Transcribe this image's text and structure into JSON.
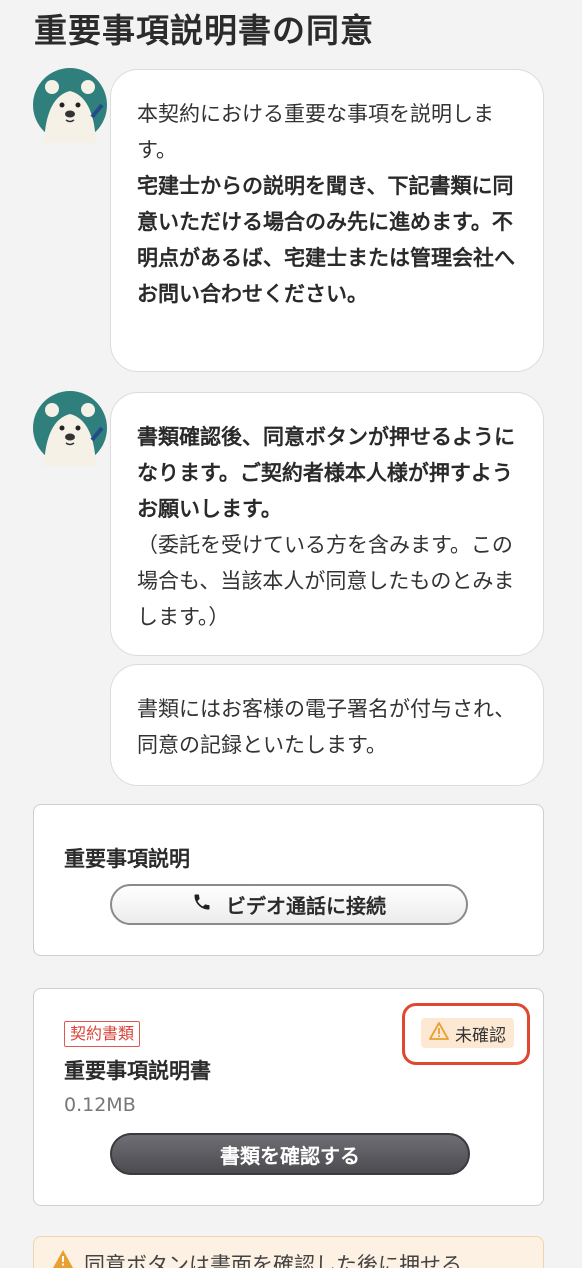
{
  "page": {
    "title": "重要事項説明書の同意"
  },
  "messages": [
    {
      "normal": "本契約における重要な事項を説明します。",
      "bold": "宅建士からの説明を聞き、下記書類に同意いただける場合のみ先に進めます。不明点があるば、宅建士または管理会社へお問い合わせください。"
    },
    {
      "bold": "書類確認後、同意ボタンが押せるようになります。ご契約者様本人様が押すようお願いします。",
      "normal": "（委託を受けている方を含みます。この場合も、当該本人が同意したものとみまします。）"
    },
    {
      "normal": "書類にはお客様の電子署名が付与され、同意の記録といたします。"
    }
  ],
  "explanation_card": {
    "title": "重要事項説明",
    "video_button_label": "ビデオ通話に接続",
    "video_button_icon": "phone-icon"
  },
  "document_card": {
    "tag": "契約書類",
    "status": "未確認",
    "status_icon": "warning-icon",
    "name": "重要事項説明書",
    "size": "0.12MB",
    "confirm_button_label": "書類を確認する"
  },
  "notice": {
    "icon": "warning-icon",
    "text": "同意ボタンは書面を確認した後に押せる"
  },
  "colors": {
    "accent_red": "#e0472f",
    "tag_red": "#d9443a",
    "avatar_bg": "#2f7f7c",
    "status_bg": "#fde8d4",
    "button_dark": "#4b4b50"
  }
}
